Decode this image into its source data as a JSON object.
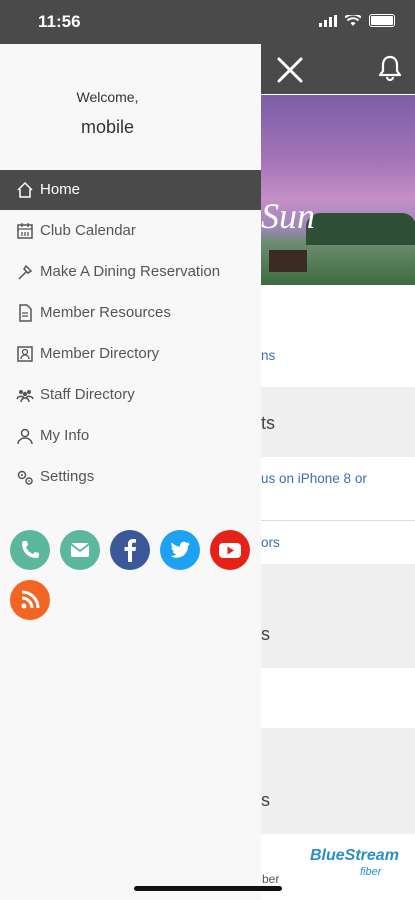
{
  "status": {
    "time": "11:56"
  },
  "drawer": {
    "welcome": "Welcome,",
    "username": "mobile",
    "items": [
      {
        "label": "Home",
        "icon": "home-icon",
        "active": true
      },
      {
        "label": "Club Calendar",
        "icon": "calendar-icon"
      },
      {
        "label": "Make A Dining Reservation",
        "icon": "utensils-icon"
      },
      {
        "label": "Member Resources",
        "icon": "document-icon"
      },
      {
        "label": "Member Directory",
        "icon": "contact-card-icon"
      },
      {
        "label": "Staff Directory",
        "icon": "users-icon"
      },
      {
        "label": "My Info",
        "icon": "person-icon"
      },
      {
        "label": "Settings",
        "icon": "gears-icon"
      }
    ],
    "social": [
      {
        "name": "phone-icon",
        "color": "#5cb89c"
      },
      {
        "name": "email-icon",
        "color": "#5cb89c"
      },
      {
        "name": "facebook-icon",
        "color": "#3b5998"
      },
      {
        "name": "twitter-icon",
        "color": "#1da1f2"
      },
      {
        "name": "youtube-icon",
        "color": "#e62117"
      },
      {
        "name": "rss-icon",
        "color": "#f26522"
      }
    ]
  },
  "background": {
    "hero_text": "Sun",
    "row1_link": "ns",
    "row2_text": "ts",
    "row3_link": "us on iPhone 8 or",
    "row4_link": "ors",
    "row5_text": "s",
    "row6_text": "s",
    "footer_text": "ber",
    "logo": "BlueStream",
    "logo_sub": "fiber"
  },
  "colors": {
    "header": "#4a4a4a",
    "active": "#4a4a4a",
    "link": "#3a6fb0"
  }
}
